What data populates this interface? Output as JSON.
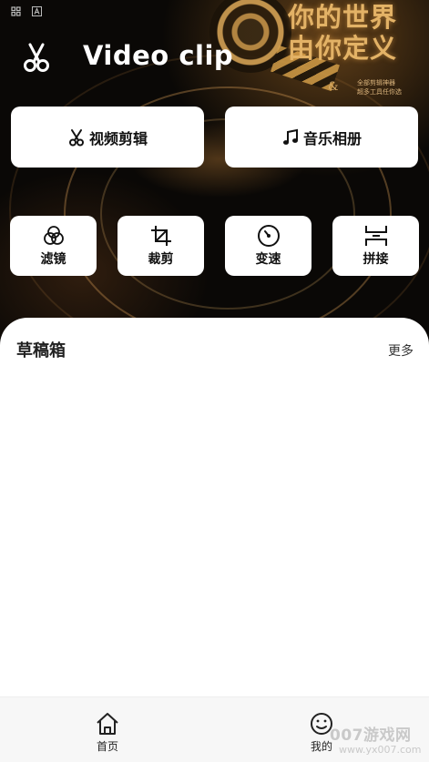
{
  "status_bar": {
    "icons": [
      "app-grid-icon",
      "a-icon"
    ]
  },
  "brand": {
    "title": "Video clip",
    "icon": "scissors-icon"
  },
  "poster": {
    "title_line1": "你的世界",
    "title_line2": "由你定义",
    "amp": "&",
    "sub_line1": "全部剪辑神器",
    "sub_line2": "超多工具任你选"
  },
  "main_actions": [
    {
      "label": "视频剪辑",
      "icon": "scissors-icon"
    },
    {
      "label": "音乐相册",
      "icon": "music-note-icon"
    }
  ],
  "tools": [
    {
      "label": "滤镜",
      "icon": "filter-circles-icon"
    },
    {
      "label": "裁剪",
      "icon": "crop-icon"
    },
    {
      "label": "变速",
      "icon": "speed-dial-icon"
    },
    {
      "label": "拼接",
      "icon": "splice-icon"
    }
  ],
  "drafts": {
    "title": "草稿箱",
    "more": "更多"
  },
  "bottom_nav": [
    {
      "label": "首页",
      "icon": "home-icon"
    },
    {
      "label": "我的",
      "icon": "smiley-icon"
    }
  ],
  "watermark": {
    "logo": "007游戏网",
    "url": "www.yx007.com"
  },
  "colors": {
    "accent_gold": "#e3b266",
    "background_dark": "#0a0806",
    "card": "#ffffff"
  }
}
